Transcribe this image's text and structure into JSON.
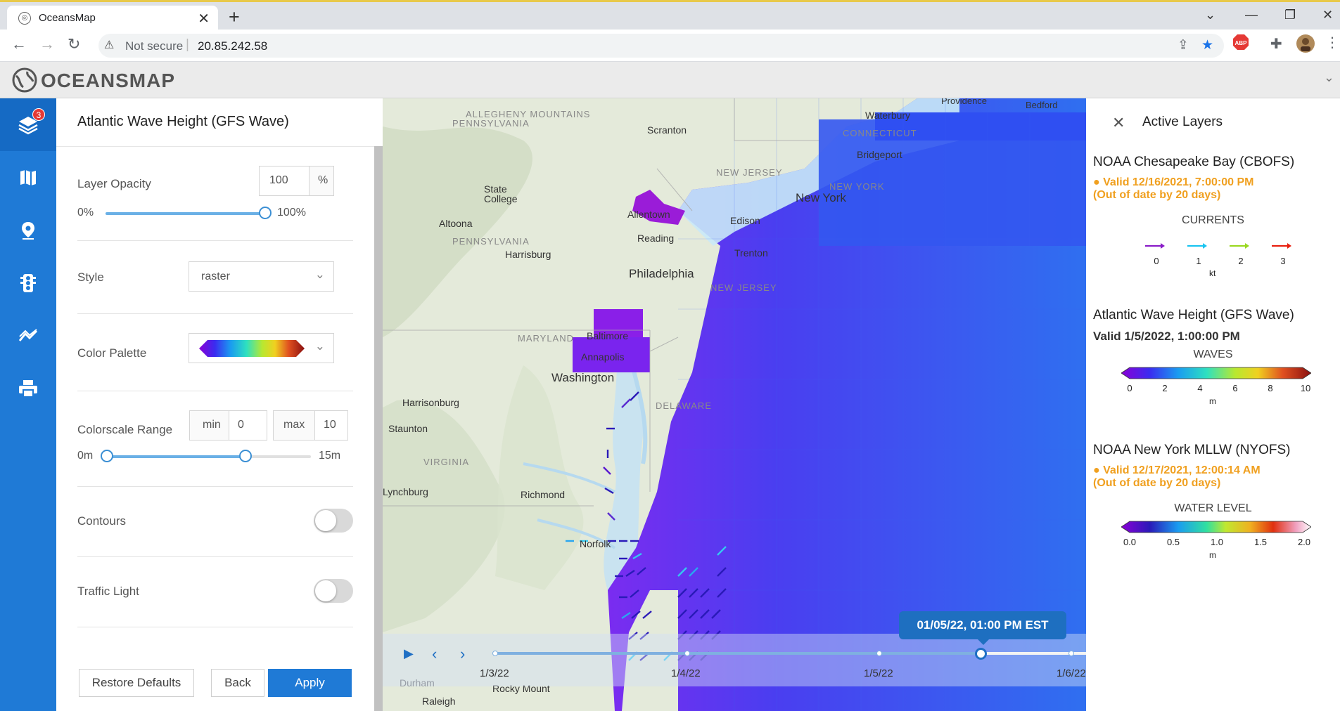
{
  "browser": {
    "tab_title": "OceansMap",
    "security_label": "Not secure",
    "url": "20.85.242.58"
  },
  "app": {
    "logo": "OCEANSMAP",
    "layers_badge": "3"
  },
  "panel": {
    "title": "Atlantic Wave Height (GFS Wave)",
    "opacity_label": "Layer Opacity",
    "opacity_value": "100",
    "opacity_unit": "%",
    "opacity_min_label": "0%",
    "opacity_max_label": "100%",
    "opacity_level": 1.0,
    "style_label": "Style",
    "style_value": "raster",
    "palette_label": "Color Palette",
    "colorscale_label": "Colorscale Range",
    "min_label": "min",
    "min_value": "0",
    "max_label": "max",
    "max_value": "10",
    "range_min_label": "0m",
    "range_max_label": "15m",
    "contours_label": "Contours",
    "contours_on": false,
    "traffic_label": "Traffic Light",
    "traffic_on": false,
    "restore_label": "Restore Defaults",
    "back_label": "Back",
    "apply_label": "Apply"
  },
  "map": {
    "places": {
      "providence": "Providence",
      "bedford": "Bedford",
      "waterbury": "Waterbury",
      "scranton": "Scranton",
      "connecticut": "CONNECTICUT",
      "bridgeport": "Bridgeport",
      "new_jersey": "NEW JERSEY",
      "new_york_state": "NEW YORK",
      "new_york": "New York",
      "state_college": "State College",
      "allentown": "Allentown",
      "edison": "Edison",
      "altoona": "Altoona",
      "pennsylvania": "PENNSYLVANIA",
      "pennsylvania_top": "PENNSYLVANIA",
      "allegheny": "ALLEGHENY MOUNTAINS",
      "reading": "Reading",
      "harrisburg": "Harrisburg",
      "trenton": "Trenton",
      "philadelphia": "Philadelphia",
      "new_jersey_south": "NEW JERSEY",
      "maryland": "MARYLAND",
      "baltimore": "Baltimore",
      "annapolis": "Annapolis",
      "washington": "Washington",
      "delaware": "DELAWARE",
      "harrisonburg": "Harrisonburg",
      "staunton": "Staunton",
      "virginia": "VIRGINIA",
      "lynchburg": "Lynchburg",
      "richmond": "Richmond",
      "norfolk": "Norfolk",
      "durham": "Durham",
      "rocky_mount": "Rocky Mount",
      "raleigh": "Raleigh"
    },
    "timeline": {
      "tooltip": "01/05/22, 01:00 PM EST",
      "dates": [
        "1/3/22",
        "1/4/22",
        "1/5/22",
        "1/6/22"
      ]
    }
  },
  "active_layers": {
    "title": "Active Layers",
    "layers": [
      {
        "name": "NOAA Chesapeake Bay (CBOFS)",
        "status": "Valid 12/16/2021, 7:00:00 PM",
        "status_note": "(Out of date by 20 days)",
        "legend_title": "CURRENTS",
        "ticks": [
          "0",
          "1",
          "2",
          "3"
        ],
        "unit": "kt"
      },
      {
        "name": "Atlantic Wave Height (GFS Wave)",
        "status": "Valid 1/5/2022, 1:00:00 PM",
        "legend_title": "WAVES",
        "ticks": [
          "0",
          "2",
          "4",
          "6",
          "8",
          "10"
        ],
        "unit": "m"
      },
      {
        "name": "NOAA New York MLLW (NYOFS)",
        "status": "Valid 12/17/2021, 12:00:14 AM",
        "status_note": "(Out of date by 20 days)",
        "legend_title": "WATER LEVEL",
        "ticks": [
          "0.0",
          "0.5",
          "1.0",
          "1.5",
          "2.0"
        ],
        "unit": "m"
      }
    ]
  },
  "colors": {
    "accent": "#1f7ad6",
    "warning": "#f0a020"
  }
}
